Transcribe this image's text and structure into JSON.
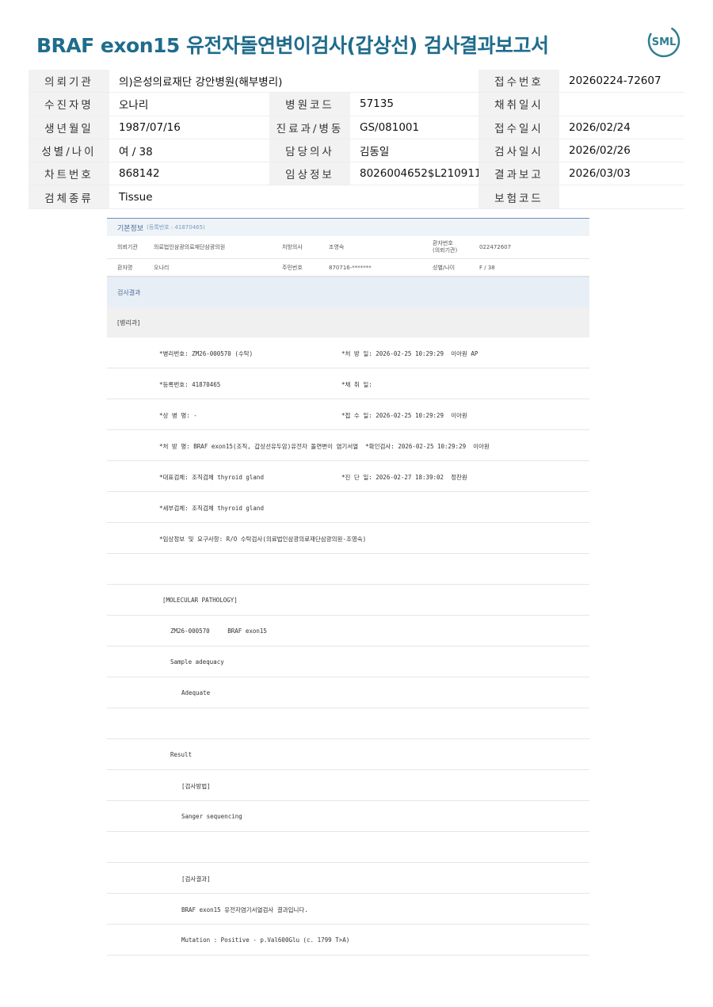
{
  "title": "BRAF exon15 유전자돌연변이검사(갑상선) 검사결과보고서",
  "logo_text": "SML",
  "header_rows": [
    [
      "의뢰기관",
      "의)은성의료재단 강안병원(해부병리)",
      "",
      "",
      "접수번호",
      "20260224-72607"
    ],
    [
      "수진자명",
      "오나리",
      "병원코드",
      "57135",
      "채취일시",
      ""
    ],
    [
      "생년월일",
      "1987/07/16",
      "진료과/병동",
      "GS/081001",
      "접수일시",
      "2026/02/24"
    ],
    [
      "성별/나이",
      "여 / 38",
      "담당의사",
      "김동일",
      "검사일시",
      "2026/02/26"
    ],
    [
      "차트번호",
      "868142",
      "임상정보",
      "8026004652$L210911",
      "결과보고",
      "2026/03/03"
    ],
    [
      "검체종류",
      "Tissue",
      "",
      "",
      "보험코드",
      ""
    ]
  ],
  "basic_info": {
    "title": "기본정보",
    "sub": "(등록번호 : 41870465)",
    "row1": [
      "의뢰기관",
      "의료법인삼광의료재단삼광의원",
      "처방의사",
      "조영숙",
      "환자번호\n(의뢰기관)",
      "022472607"
    ],
    "row2": [
      "환자명",
      "오나리",
      "주민번호",
      "870716-*******",
      "성별/나이",
      "F / 38"
    ]
  },
  "result_section": "검사결과",
  "pathology_section": "[병리과]",
  "result_lines": [
    [
      "*병리번호: ZM26-000570 (수탁)",
      "*처 방 일: 2026-02-25 10:29:29  이아원 AP"
    ],
    [
      "*등록번호: 41870465",
      "*채 취 일:"
    ],
    [
      "*상 병 명: -",
      "*접 수 일: 2026-02-25 10:29:29  이아원"
    ],
    [
      "*처 방 명: BRAF exon15(조직, 갑상선유두암)유전자 돌연변이 염기서열  *확인검사: 2026-02-25 10:29:29  이아원",
      ""
    ],
    [
      "*대표검체: 조직검체 thyroid gland",
      "*진 단 일: 2026-02-27 18:39:02  정찬원"
    ],
    [
      "*세부검체: 조직검체 thyroid gland",
      ""
    ],
    [
      "*임상정보 및 요구사항: R/O 수탁검사(의료법인삼광의료재단삼광의원-조영숙)",
      ""
    ],
    [
      "",
      ""
    ],
    [
      "[MOLECULAR PATHOLOGY]",
      ""
    ],
    [
      "ZM26-000570     BRAF exon15",
      ""
    ],
    [
      "Sample adequacy",
      ""
    ],
    [
      "Adequate",
      ""
    ],
    [
      "",
      ""
    ],
    [
      "Result",
      ""
    ],
    [
      "[검사방법]",
      ""
    ],
    [
      "Sanger sequencing",
      ""
    ],
    [
      "",
      ""
    ],
    [
      "[검사결과]",
      ""
    ],
    [
      "BRAF exon15 유전자염기서열검사 결과입니다.",
      ""
    ],
    [
      "Mutation : Positive - p.Val600Glu (c. 1799 T>A)",
      ""
    ]
  ]
}
